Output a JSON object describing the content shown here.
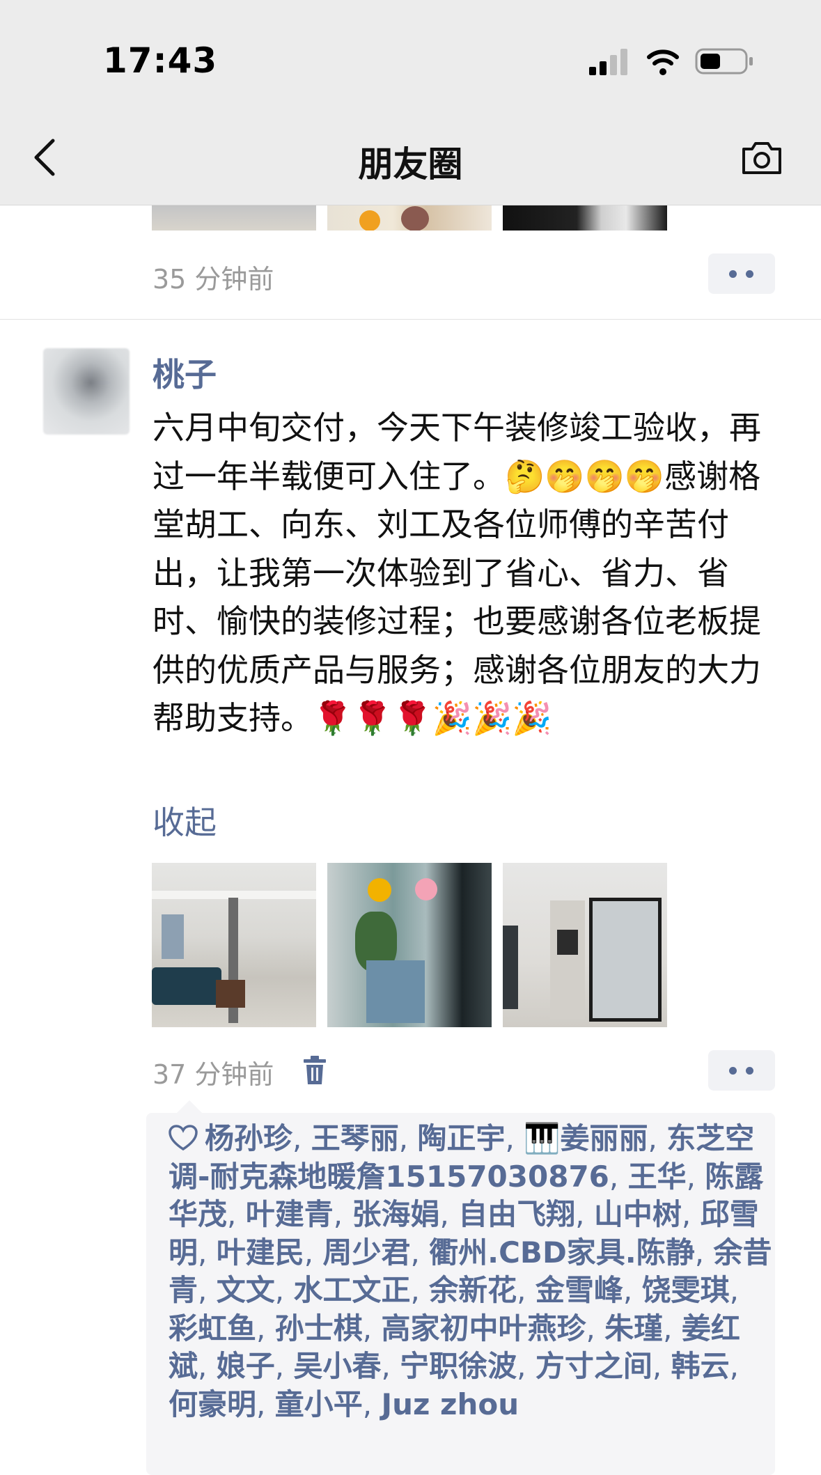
{
  "status_bar": {
    "time": "17:43"
  },
  "nav": {
    "title": "朋友圈"
  },
  "previous_post": {
    "time": "35 分钟前"
  },
  "post": {
    "author": "桃子",
    "text": "六月中旬交付，今天下午装修竣工验收，再过一年半载便可入住了。🤔🤭🤭🤭感谢格堂胡工、向东、刘工及各位师傅的辛苦付出，让我第一次体验到了省心、省力、省时、愉快的装修过程；也要感谢各位老板提供的优质产品与服务；感谢各位朋友的大力帮助支持。🌹🌹🌹🎉🎉🎉",
    "collapse_label": "收起",
    "time": "37 分钟前",
    "likes": [
      "杨孙珍",
      "王琴丽",
      "陶正宇",
      "🎹姜丽丽",
      "东芝空调-耐克森地暖詹15157030876",
      "王华",
      "陈露华茂",
      "叶建青",
      "张海娟",
      "自由飞翔",
      "山中树",
      "邱雪明",
      "叶建民",
      "周少君",
      "衢州.CBD家具.陈静",
      "余昔青",
      "文文",
      "水工文正",
      "余新花",
      "金雪峰",
      "饶雯琪",
      "彩虹鱼",
      "孙士棋",
      "高家初中叶燕珍",
      "朱瑾",
      "姜红斌",
      "娘子",
      "吴小春",
      "宁职徐波",
      "方寸之间",
      "韩云",
      "何豪明",
      "童小平",
      "Juz zhou"
    ]
  },
  "colors": {
    "link": "#576b95",
    "timestamp": "#9a9a9a",
    "nav_bg": "#ececec"
  }
}
